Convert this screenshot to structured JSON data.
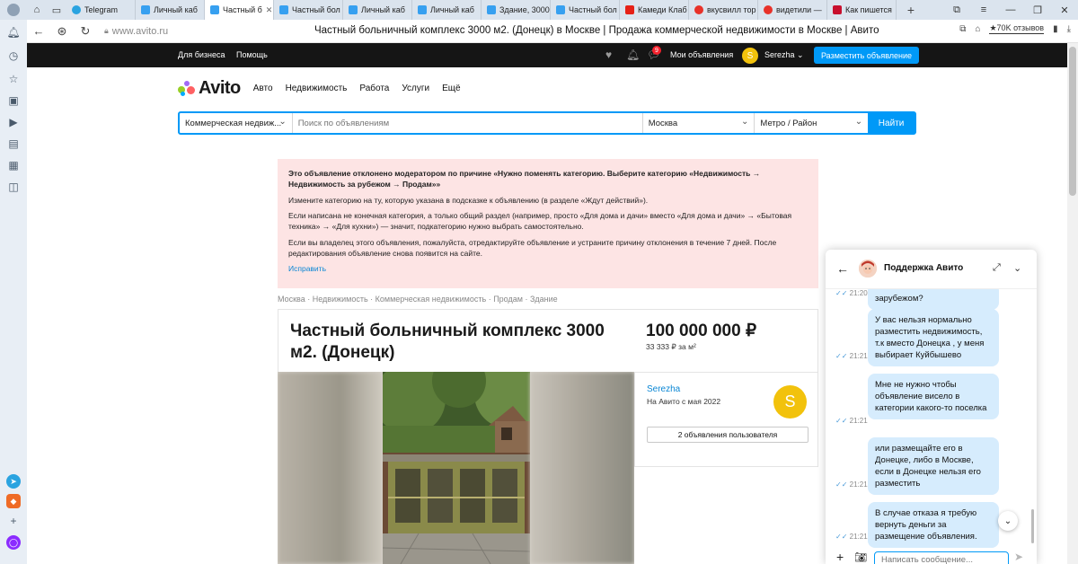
{
  "browser": {
    "tabs": [
      {
        "label": "",
        "color": "#6d7f93"
      },
      {
        "label": "Telegram",
        "color": "#2aa3e0"
      },
      {
        "label": "Личный каб",
        "color": "#37a0f0"
      },
      {
        "label": "Частный б",
        "color": "#37a0f0",
        "active": true
      },
      {
        "label": "Частный бол",
        "color": "#37a0f0"
      },
      {
        "label": "Личный каб",
        "color": "#37a0f0"
      },
      {
        "label": "Личный каб",
        "color": "#37a0f0"
      },
      {
        "label": "Здание, 3000",
        "color": "#37a0f0"
      },
      {
        "label": "Частный бол",
        "color": "#37a0f0"
      },
      {
        "label": "Камеди Клаб",
        "color": "#e62117"
      },
      {
        "label": "вкусвилл тор",
        "color": "#e8322a"
      },
      {
        "label": "видетили —",
        "color": "#e8322a"
      },
      {
        "label": "Как пишется",
        "color": "#c8102e"
      }
    ],
    "url": "www.avito.ru",
    "page_title": "Частный больничный комплекс 3000 м2. (Донецк) в Москве | Продажа коммерческой недвижимости в Москве | Авито",
    "reviews": "★70K отзывов"
  },
  "topbar": {
    "for_business": "Для бизнеса",
    "help": "Помощь",
    "messages_badge": "9",
    "my_ads": "Мои объявления",
    "avatar_letter": "S",
    "username": "Serezha",
    "place_ad": "Разместить объявление"
  },
  "header": {
    "logo": "Avito",
    "categories": [
      "Авто",
      "Недвижимость",
      "Работа",
      "Услуги",
      "Ещё"
    ]
  },
  "search": {
    "category": "Коммерческая недвиж...",
    "placeholder": "Поиск по объявлениям",
    "city": "Москва",
    "metro": "Метро / Район",
    "find": "Найти"
  },
  "alert": {
    "heading": "Это объявление отклонено модератором по причине «Нужно поменять категорию. Выберите категорию «Недвижимость → Недвижимость за рубежом → Продам»»",
    "p1": "Измените категорию на ту, которую указана в подсказке к объявлению (в разделе «Ждут действий»).",
    "p2": "Если написана не конечная категория, а только общий раздел (например, просто «Для дома и дачи» вместо «Для дома и дачи» → «Бытовая техника» → «Для кухни») — значит, подкатегорию нужно выбрать самостоятельно.",
    "p3": "Если вы владелец этого объявления, пожалуйста, отредактируйте объявление и устраните причину отклонения в течение 7 дней. После редактирования объявление снова появится на сайте.",
    "fix": "Исправить"
  },
  "breadcrumbs": [
    "Москва",
    "Недвижимость",
    "Коммерческая недвижимость",
    "Продам",
    "Здание"
  ],
  "ad": {
    "title": "Частный больничный комплекс 3000 м2. (Донецк)",
    "price": "100 000 000 ₽",
    "price_per_m2": "33 333 ₽ за м²"
  },
  "seller": {
    "name": "Serezha",
    "since": "На Авито с мая 2022",
    "avatar_letter": "S",
    "ads_button": "2 объявления пользователя"
  },
  "chat": {
    "title": "Поддержка Авито",
    "input_placeholder": "Написать сообщение...",
    "messages": [
      {
        "text": "зарубежом?",
        "time": "21:20"
      },
      {
        "text": "У вас нельзя нормально разместить недвижимость, т.к вместо Донецка , у меня выбирает Куйбышево",
        "time": "21:21"
      },
      {
        "text": "Мне не нужно чтобы объявление висело в категории какого-то поселка",
        "time": "21:21"
      },
      {
        "text": "или размещайте его в Донецке, либо в Москве, если в Донецке нельзя его разместить",
        "time": "21:21"
      },
      {
        "text": "В случае отказа я требую вернуть деньги за размещение объявления.",
        "time": "21:21"
      }
    ]
  }
}
